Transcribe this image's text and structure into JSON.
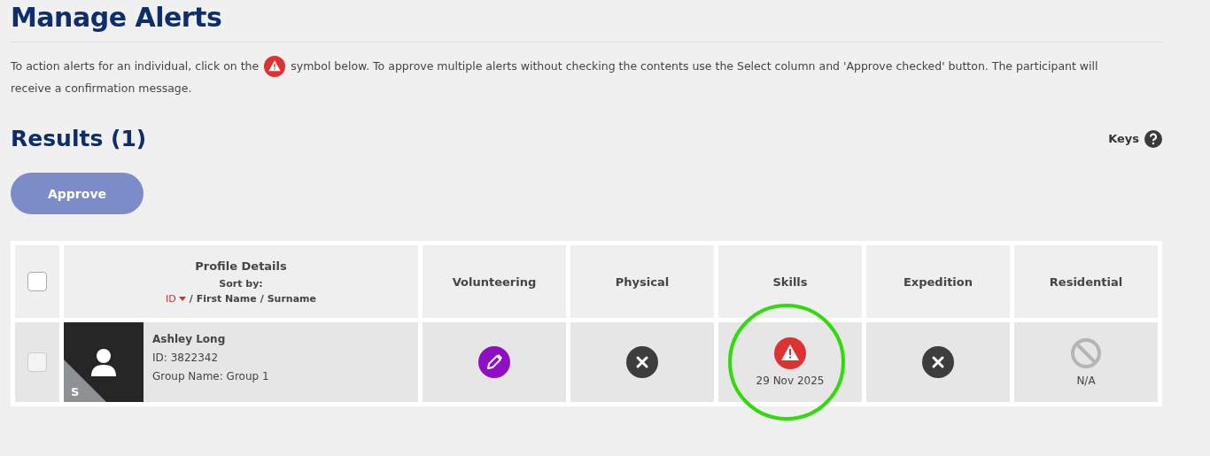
{
  "title": "Manage Alerts",
  "intro": {
    "before": "To action alerts for an individual, click on the",
    "after": [
      "symbol below. To approve multiple alerts without checking the contents use the Select column and 'Approve checked' button. The participant will",
      "receive a confirmation message."
    ]
  },
  "results_title": "Results (1)",
  "keys_label": "Keys",
  "approve_button": {
    "label": "Approve",
    "disabled": true
  },
  "table": {
    "select_all_checked": false,
    "profile_header": {
      "title": "Profile Details",
      "sort_label": "Sort by:",
      "separator": "/",
      "sort_options": [
        {
          "label": "ID",
          "selected": true
        },
        {
          "label": "First Name",
          "selected": false
        },
        {
          "label": "Surname",
          "selected": false
        }
      ]
    },
    "columns": [
      "Volunteering",
      "Physical",
      "Skills",
      "Expedition",
      "Residential"
    ],
    "rows": [
      {
        "checked": false,
        "disabled": true,
        "avatar_badge": "S",
        "name": "Ashley Long",
        "id": "ID: 3822342",
        "group": "Group Name: Group 1",
        "cells": [
          {
            "kind": "edit",
            "highlighted": false
          },
          {
            "kind": "declined",
            "highlighted": false
          },
          {
            "kind": "alert",
            "text": "29 Nov 2025",
            "highlighted": true
          },
          {
            "kind": "declined",
            "highlighted": false
          },
          {
            "kind": "not-applicable",
            "text": "N/A",
            "highlighted": false
          }
        ]
      }
    ]
  }
}
